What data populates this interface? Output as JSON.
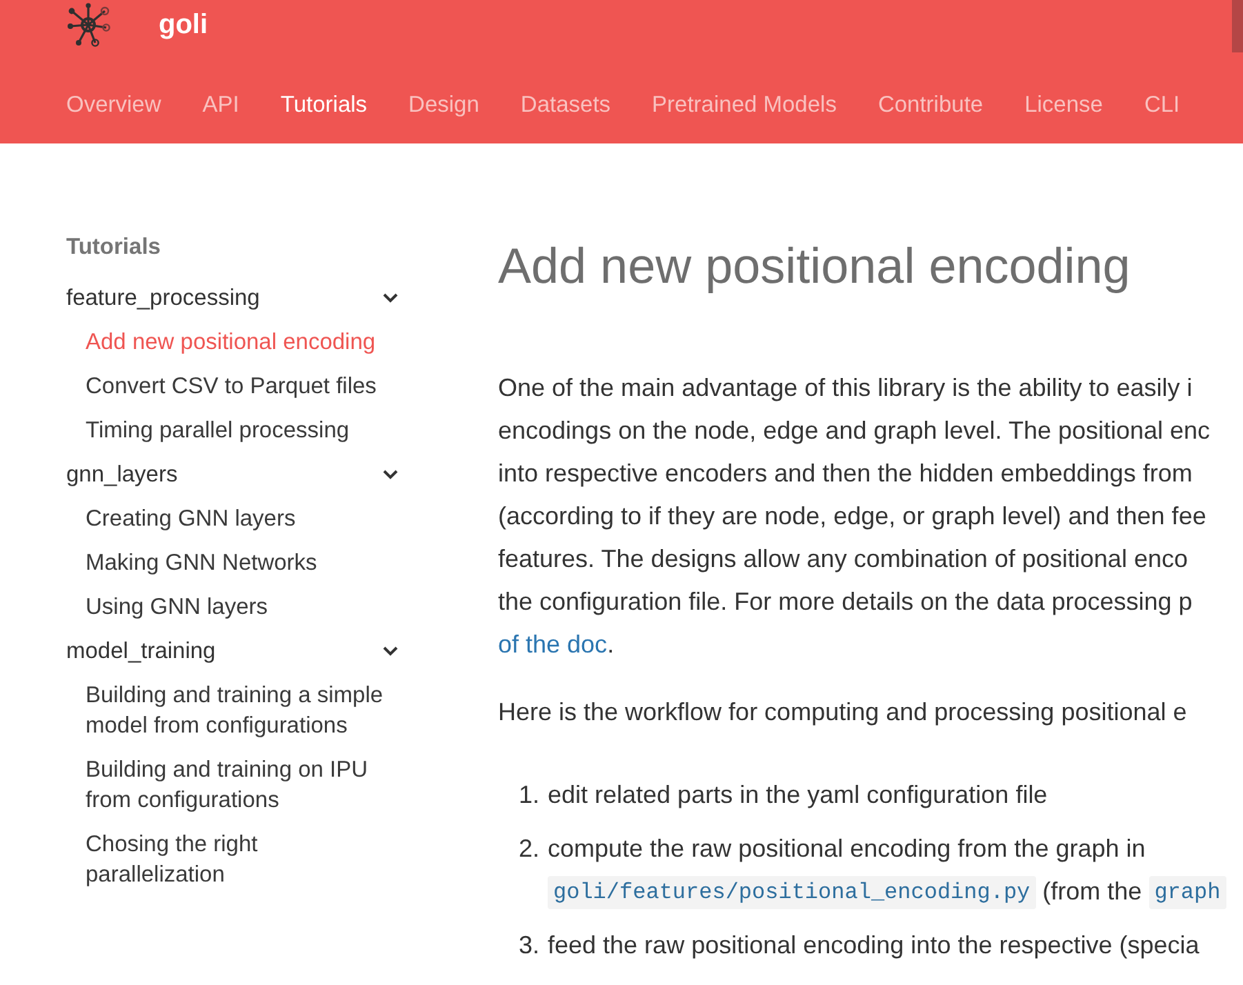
{
  "header": {
    "site_title": "goli",
    "nav": [
      {
        "label": "Overview",
        "selected": false
      },
      {
        "label": "API",
        "selected": false
      },
      {
        "label": "Tutorials",
        "selected": true
      },
      {
        "label": "Design",
        "selected": false
      },
      {
        "label": "Datasets",
        "selected": false
      },
      {
        "label": "Pretrained Models",
        "selected": false
      },
      {
        "label": "Contribute",
        "selected": false
      },
      {
        "label": "License",
        "selected": false
      },
      {
        "label": "CLI",
        "selected": false
      }
    ]
  },
  "sidebar": {
    "heading": "Tutorials",
    "groups": [
      {
        "label": "feature_processing",
        "expanded": true,
        "items": [
          {
            "label": "Add new positional encoding",
            "selected": true
          },
          {
            "label": "Convert CSV to Parquet files",
            "selected": false
          },
          {
            "label": "Timing parallel processing",
            "selected": false
          }
        ]
      },
      {
        "label": "gnn_layers",
        "expanded": true,
        "items": [
          {
            "label": "Creating GNN layers",
            "selected": false
          },
          {
            "label": "Making GNN Networks",
            "selected": false
          },
          {
            "label": "Using GNN layers",
            "selected": false
          }
        ]
      },
      {
        "label": "model_training",
        "expanded": true,
        "items": [
          {
            "label": "Building and training a simple model from configurations",
            "selected": false
          },
          {
            "label": "Building and training on IPU from configurations",
            "selected": false
          },
          {
            "label": "Chosing the right parallelization",
            "selected": false
          }
        ]
      }
    ]
  },
  "article": {
    "title": "Add new positional encoding",
    "intro": {
      "lines": [
        "One of the main advantage of this library is the ability to easily i",
        "encodings on the node, edge and graph level. The positional enc",
        "into respective encoders and then the hidden embeddings from",
        "(according to if they are node, edge, or graph level) and then fee",
        "features. The designs allow any combination of positional enco",
        "the configuration file. For more details on the data processing p"
      ],
      "link": "of the doc",
      "after_link": "."
    },
    "workflow_intro": "Here is the workflow for computing and processing positional e",
    "steps": [
      {
        "number": "1.",
        "lines": [
          [
            {
              "kind": "text",
              "text": "edit related parts in the yaml configuration file"
            }
          ]
        ]
      },
      {
        "number": "2.",
        "lines": [
          [
            {
              "kind": "text",
              "text": "compute the raw positional encoding from the graph in"
            }
          ],
          [
            {
              "kind": "code",
              "text": "goli/features/positional_encoding.py"
            },
            {
              "kind": "text",
              "text": "(from the"
            },
            {
              "kind": "code",
              "text": "graph"
            }
          ]
        ]
      },
      {
        "number": "3.",
        "lines": [
          [
            {
              "kind": "text",
              "text": "feed the raw positional encoding into the respective (specia"
            }
          ]
        ]
      }
    ]
  }
}
